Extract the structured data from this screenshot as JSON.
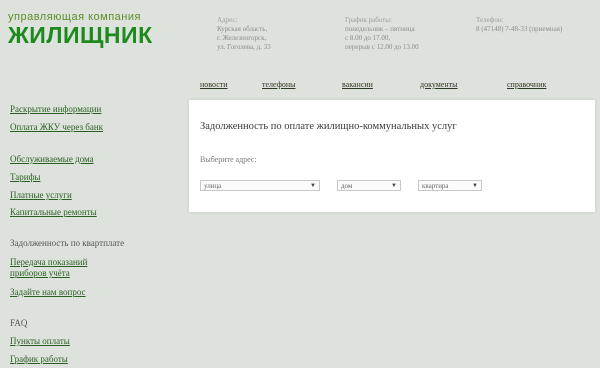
{
  "logo": {
    "subtitle": "управляющая компания",
    "name": "ЖИЛИЩНИК"
  },
  "contacts": {
    "address": {
      "title": "Адрес:",
      "lines": [
        "Курская область,",
        "г. Железногорск,",
        "ул. Гоголева, д. 33"
      ]
    },
    "hours": {
      "title": "График работы:",
      "lines": [
        "понедельник – пятница",
        "с 8.00 до 17.00,",
        "перерыв с 12.00 до 13.00"
      ]
    },
    "phone": {
      "title": "Телефон:",
      "lines": [
        "8 (47148) 7-48-33 (приемная)"
      ]
    }
  },
  "nav": [
    "новости",
    "телефоны",
    "вакансии",
    "документы",
    "справочник"
  ],
  "sidebar": {
    "items": [
      {
        "label": "Раскрытие информации",
        "type": "link"
      },
      {
        "label": "Оплата ЖКУ через банк",
        "type": "link"
      },
      {
        "label": "Обслуживаемые дома",
        "type": "link"
      },
      {
        "label": "Тарифы",
        "type": "link"
      },
      {
        "label": "Платные услуги",
        "type": "link"
      },
      {
        "label": "Капитальные ремонты",
        "type": "link"
      },
      {
        "label": "Задолженность по квартплате",
        "type": "head"
      },
      {
        "label": "Передача показаний",
        "type": "link"
      },
      {
        "label": "приборов учёта",
        "type": "link"
      },
      {
        "label": "Задайте нам вопрос",
        "type": "link"
      },
      {
        "label": "FAQ",
        "type": "head"
      },
      {
        "label": "Пункты оплаты",
        "type": "link"
      },
      {
        "label": "График работы",
        "type": "link"
      }
    ]
  },
  "panel": {
    "title": "Задолженность по оплате жилищно-коммунальных услуг",
    "select_label": "Выберите адрес:",
    "selects": {
      "street": "улица",
      "house": "дом",
      "apartment": "квартира"
    }
  }
}
